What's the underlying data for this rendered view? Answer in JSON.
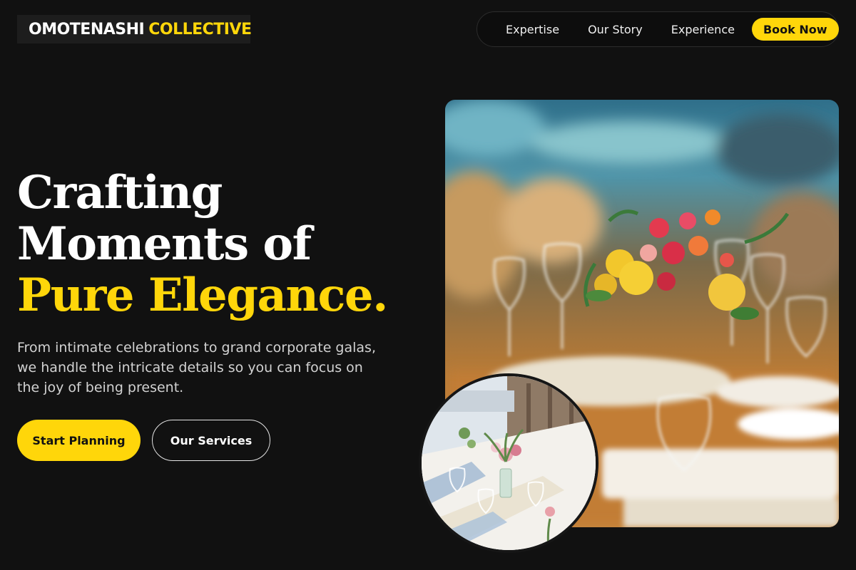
{
  "brand": {
    "name": "OMOTENASHI",
    "accent": "COLLECTIVE"
  },
  "nav": {
    "links": [
      "Expertise",
      "Our Story",
      "Experience"
    ],
    "cta": "Book Now"
  },
  "hero": {
    "headline_line1": "Crafting",
    "headline_line2": "Moments of",
    "headline_accent": "Pure Elegance.",
    "description": "From intimate celebrations to grand corporate galas, we handle the intricate details so you can focus on the joy of being present.",
    "primary_button": "Start Planning",
    "secondary_button": "Our Services"
  },
  "theme": {
    "background": "#111111",
    "accent": "#ffd60a",
    "text": "#ffffff"
  }
}
